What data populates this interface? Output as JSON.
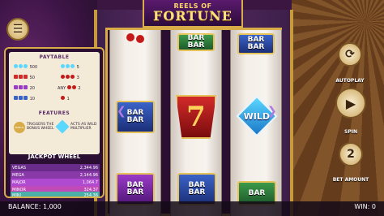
{
  "title": {
    "small": "REELS OF",
    "big": "FORTUNE"
  },
  "colors": {
    "accent_gold": "#d8ac48",
    "purple": "#5a2b66",
    "seven_red": "#d32a2a",
    "wild_blue": "#5ad8ff"
  },
  "menu_icon": "hamburger-icon",
  "paytable": {
    "header": "PAYTABLE",
    "payouts_left": [
      "500",
      "50",
      "20",
      "10"
    ],
    "payouts_right": [
      "5",
      "3",
      "2",
      "1"
    ],
    "any_label": "ANY"
  },
  "features": {
    "header": "FEATURES",
    "bonus_text": "TRIGGERS THE BONUS WHEEL",
    "wild_text": "ACTS AS WILD MULTIPLIER",
    "bonus_icon": "BONUS",
    "wild_icon": "WILD"
  },
  "jackpot": {
    "header": "JACKPOT WHEEL",
    "rows": [
      {
        "name": "VEGAS",
        "value": "2,344.96",
        "color": "#6a2c8a"
      },
      {
        "name": "MEGA",
        "value": "2,144.96",
        "color": "#8a3aa8"
      },
      {
        "name": "MAJOR",
        "value": "1,064.7",
        "color": "#b04ad0"
      },
      {
        "name": "MINOR",
        "value": "324.37",
        "color": "#c04ab8"
      },
      {
        "name": "MINI",
        "value": "254.36",
        "color": "#4ab0a8"
      }
    ]
  },
  "reels": {
    "symbol_labels": {
      "bar": "BAR",
      "wild": "WILD",
      "seven": "7"
    }
  },
  "controls": {
    "autoplay_label": "AUTOPLAY",
    "spin_label": "SPIN",
    "bet_label": "BET AMOUNT",
    "bet_value": "2"
  },
  "status": {
    "balance": "BALANCE: 1,000",
    "win": "WIN: 0"
  }
}
